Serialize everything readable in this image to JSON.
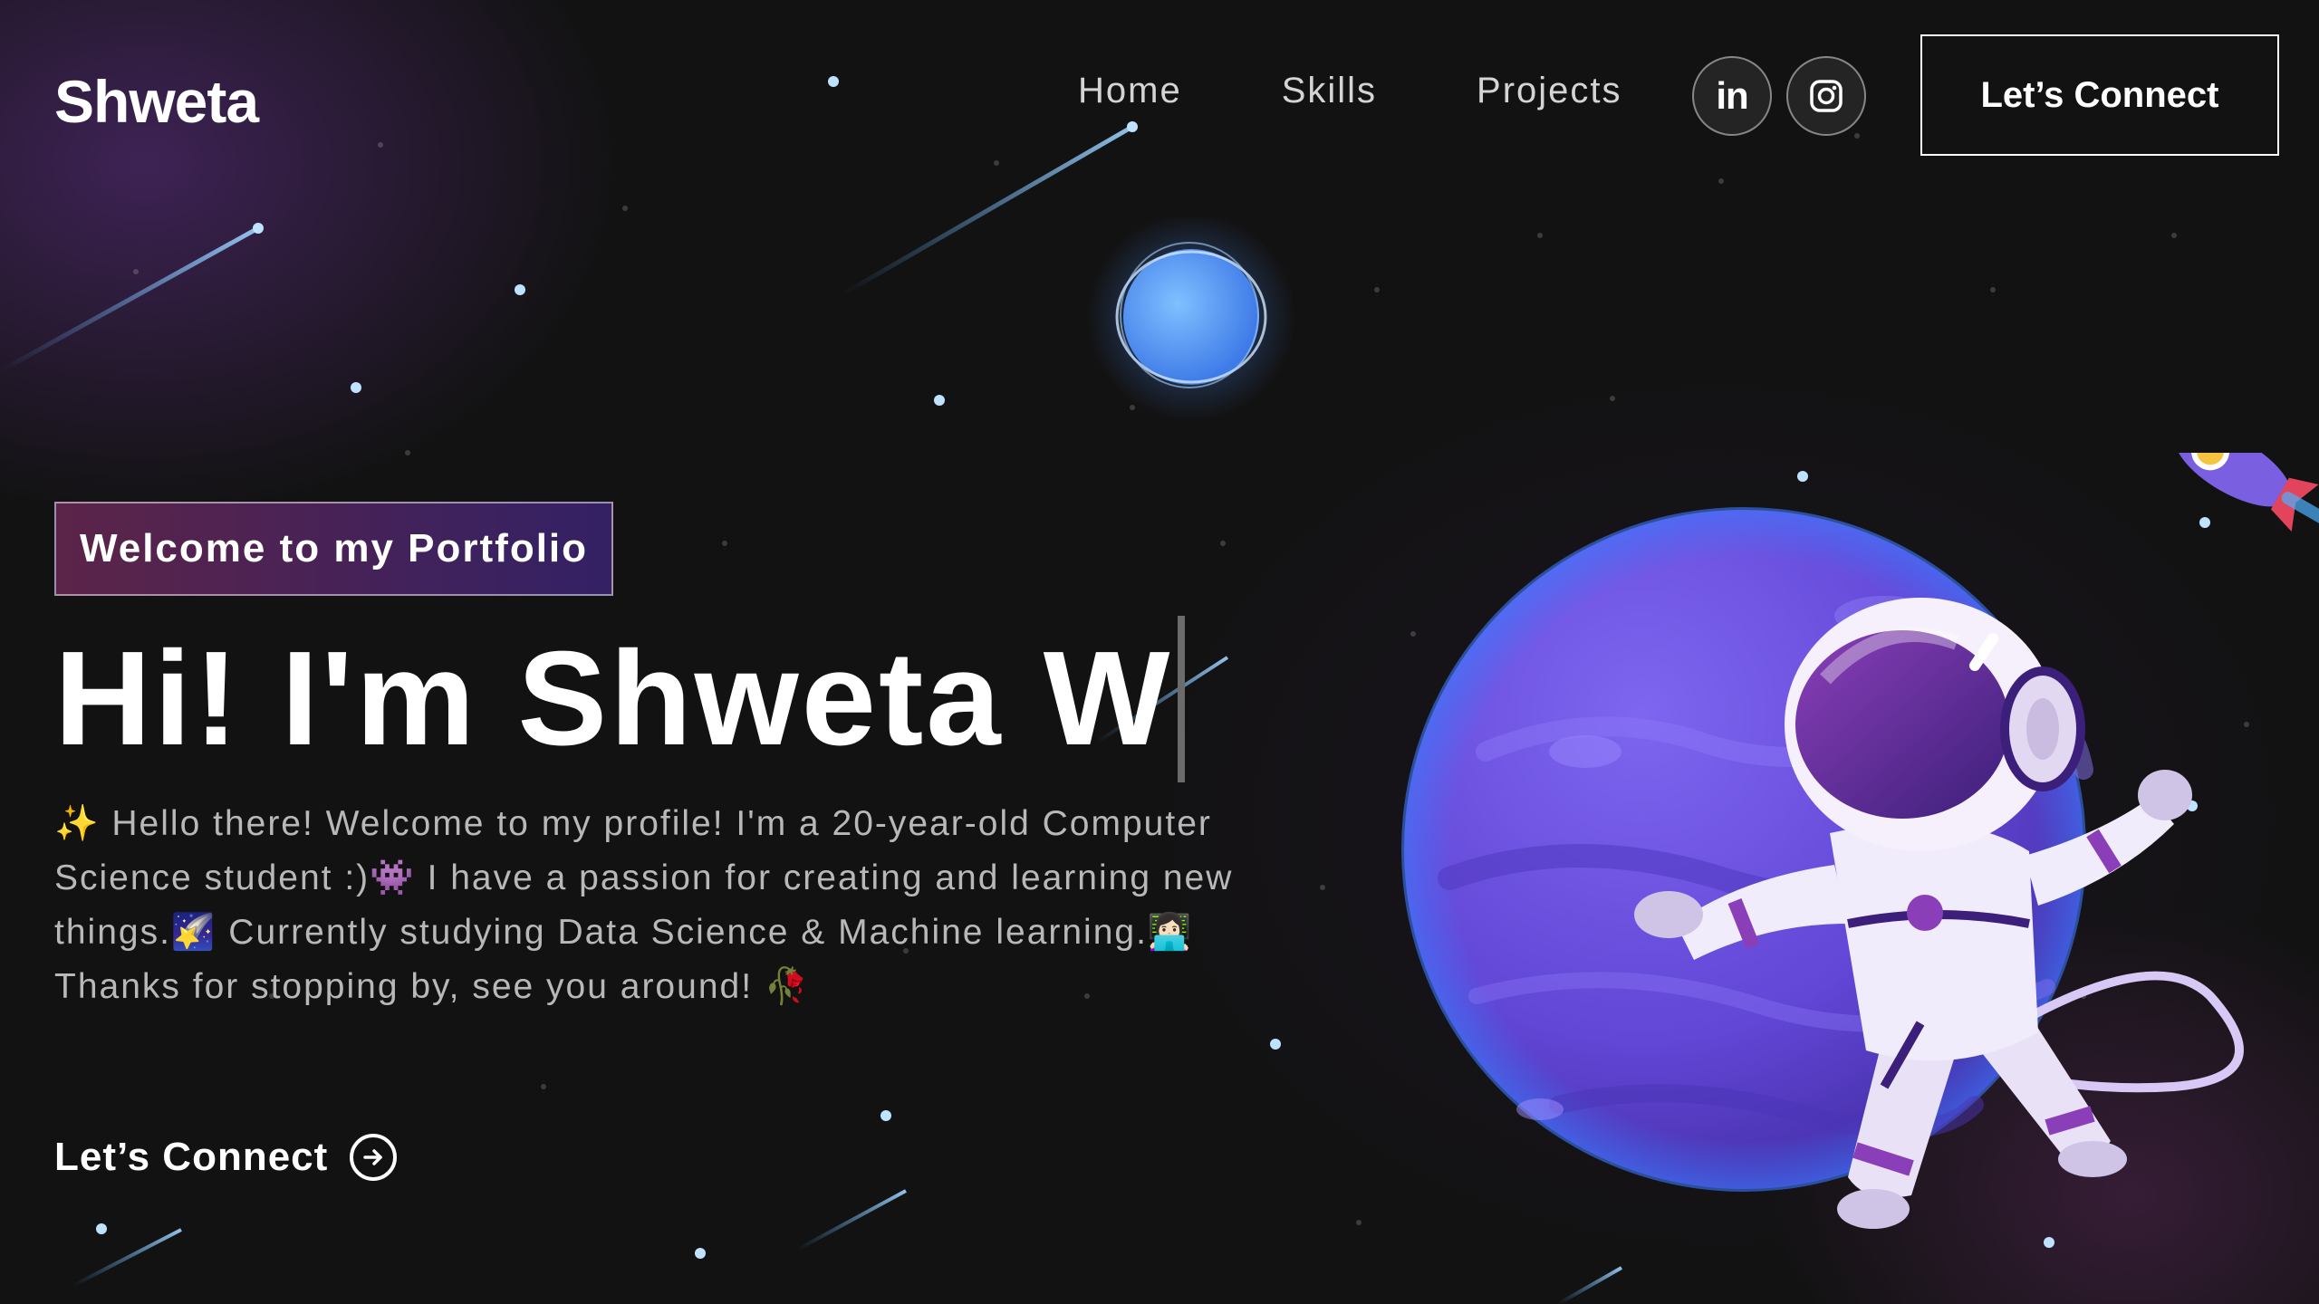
{
  "navbar": {
    "logo": "Shweta",
    "links": [
      {
        "label": "Home"
      },
      {
        "label": "Skills"
      },
      {
        "label": "Projects"
      }
    ],
    "social": [
      {
        "icon": "linkedin-icon",
        "glyph": "in"
      },
      {
        "icon": "instagram-icon"
      }
    ],
    "connect_label": "Let’s Connect"
  },
  "hero": {
    "tagline": "Welcome to my Portfolio",
    "title": "Hi! I'm Shweta W",
    "description": "✨ Hello there! Welcome to my profile! I'm a 20-year-old Computer Science student :)👾 I have a passion for creating and learning new things.🌠 Currently studying Data Science & Machine learning.👩🏻‍💻 Thanks for stopping by, see you around! 🥀",
    "connect_label": "Let’s Connect",
    "connect_icon": "arrow-right-circle-icon"
  },
  "colors": {
    "background": "#121212",
    "tagline_gradient_start": "#aa367c",
    "tagline_gradient_end": "#4a2fbd",
    "planet": "#6a4fe0",
    "text_muted": "#b8b8b8"
  }
}
